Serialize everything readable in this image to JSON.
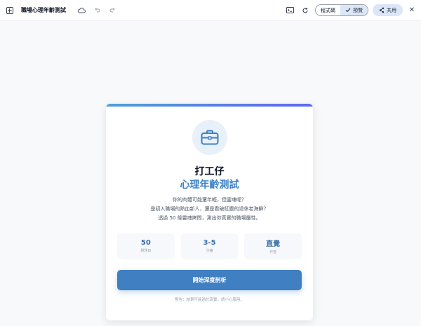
{
  "app": {
    "title": "職場心理年齡測試"
  },
  "toolbar": {
    "code_label": "程式碼",
    "preview_label": "預覽",
    "share_label": "共用"
  },
  "card": {
    "headline": "打工仔",
    "subheadline": "心理年齡測試",
    "description": [
      "你的肉體可能還年輕，但靈魂呢？",
      "是初入職場的熱血新人，還是看破紅塵的退休老海鮮？",
      "透過 50 條靈魂拷問，測出你真實的職場屬性。"
    ],
    "stats": [
      {
        "value": "50",
        "label": "題題目"
      },
      {
        "value": "3-5",
        "label": "分鐘"
      },
      {
        "value": "直覺",
        "label": "作答"
      }
    ],
    "start_label": "開始深度剖析",
    "warning": "警告：結果可能過於真實，請小心服用。"
  },
  "colors": {
    "accent": "#3f7fc2",
    "subheadline": "#3b82c4",
    "accent_gradient_start": "#4fa0d8",
    "accent_gradient_end": "#6366f1"
  },
  "icons": [
    "app-grid-icon",
    "cloud-icon",
    "undo-icon",
    "redo-icon",
    "terminal-icon",
    "refresh-icon",
    "check-icon",
    "share-icon",
    "close-icon",
    "briefcase-icon"
  ]
}
